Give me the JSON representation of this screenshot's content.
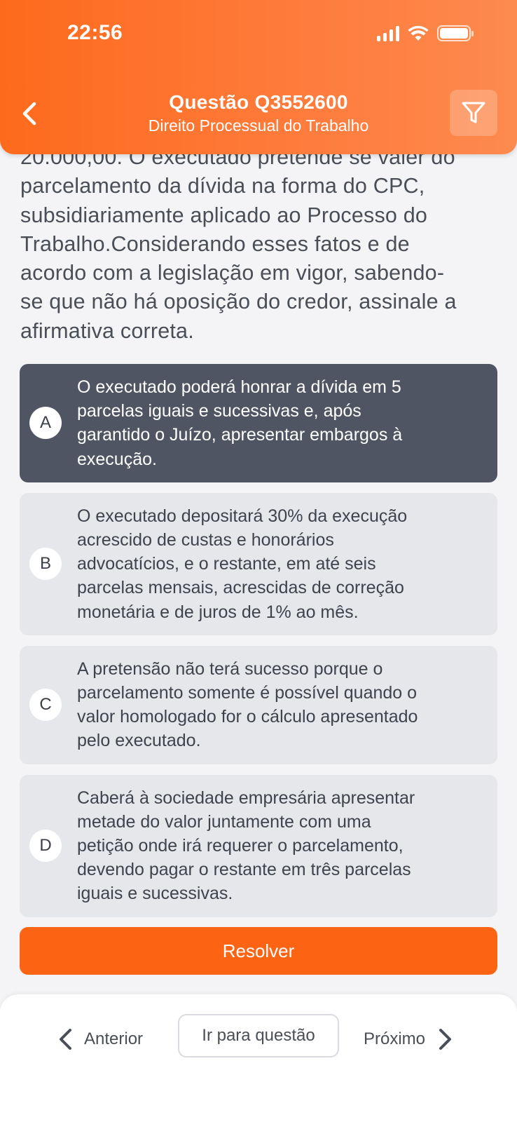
{
  "status_bar": {
    "time": "22:56"
  },
  "header": {
    "title": "Questão Q3552600",
    "subtitle": "Direito Processual do Trabalho"
  },
  "question": {
    "lines": [
      "20.000,00. O executado pretende se valer do",
      "parcelamento da dívida na forma do CPC,",
      "subsidiariamente aplicado ao Processo do",
      "Trabalho.Considerando esses fatos e de",
      "acordo com a legislação em vigor, sabendo-",
      "se que não há oposição do credor, assinale a",
      "afirmativa correta."
    ]
  },
  "options": [
    {
      "letter": "A",
      "selected": true,
      "lines": [
        "O executado poderá honrar a dívida em 5",
        "parcelas iguais e sucessivas e, após",
        "garantido o Juízo, apresentar embargos à",
        "execução."
      ]
    },
    {
      "letter": "B",
      "selected": false,
      "lines": [
        "O executado depositará 30% da execução",
        "acrescido de custas e honorários",
        "advocatícios, e o restante, em até seis",
        "parcelas mensais, acrescidas de correção",
        "monetária e de juros de 1% ao mês."
      ]
    },
    {
      "letter": "C",
      "selected": false,
      "lines": [
        "A pretensão não terá sucesso porque o",
        "parcelamento somente é possível quando o",
        "valor homologado for o cálculo apresentado",
        "pelo executado."
      ]
    },
    {
      "letter": "D",
      "selected": false,
      "lines": [
        "Caberá à sociedade empresária apresentar",
        "metade do valor juntamente com uma",
        "petição onde irá requerer o parcelamento,",
        "devendo pagar o restante em três parcelas",
        "iguais e sucessivas."
      ]
    }
  ],
  "actions": {
    "resolve_label": "Resolver"
  },
  "bottom_nav": {
    "prev_label": "Anterior",
    "goto_label": "Ir para questão",
    "next_label": "Próximo"
  },
  "colors": {
    "accent": "#fc6313",
    "selected_option": "#4f5562",
    "option_bg": "#e6e7eb"
  },
  "icons": [
    "chevron-left-icon",
    "filter-icon",
    "signal-icon",
    "wifi-icon",
    "battery-icon",
    "chevron-right-icon"
  ]
}
